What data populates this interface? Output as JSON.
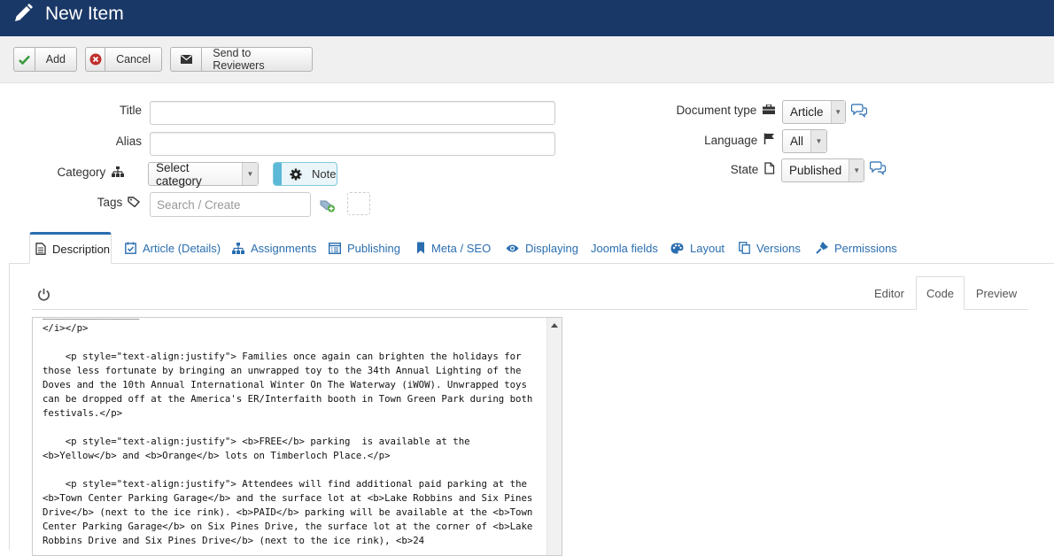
{
  "header": {
    "title": "New Item"
  },
  "toolbar": {
    "add_label": "Add",
    "cancel_label": "Cancel",
    "send_label": "Send to Reviewers"
  },
  "form": {
    "title_label": "Title",
    "title_value": "",
    "alias_label": "Alias",
    "alias_value": "",
    "category_label": "Category",
    "category_value": "Select category",
    "note_label": "Note",
    "tags_label": "Tags",
    "tags_placeholder": "Search / Create",
    "doctype_label": "Document type",
    "doctype_value": "Article",
    "language_label": "Language",
    "language_value": "All",
    "state_label": "State",
    "state_value": "Published"
  },
  "tabs": [
    {
      "label": "Description",
      "icon": "document-icon",
      "active": true
    },
    {
      "label": "Article (Details)",
      "icon": "calendar-check-icon"
    },
    {
      "label": "Assignments",
      "icon": "sitemap-icon"
    },
    {
      "label": "Publishing",
      "icon": "list-box-icon"
    },
    {
      "label": "Meta / SEO",
      "icon": "bookmark-icon"
    },
    {
      "label": "Displaying",
      "icon": "eye-icon"
    },
    {
      "label": "Joomla fields",
      "icon": ""
    },
    {
      "label": "Layout",
      "icon": "palette-icon"
    },
    {
      "label": "Versions",
      "icon": "copy-icon"
    },
    {
      "label": "Permissions",
      "icon": "plug-icon"
    }
  ],
  "editor": {
    "modes": [
      "Editor",
      "Code",
      "Preview"
    ],
    "active_mode": "Code",
    "code": "_________________\n</i></p>\n\n    <p style=\"text-align:justify\"> Families once again can brighten the holidays for those less fortunate by bringing an unwrapped toy to the 34th Annual Lighting of the Doves and the 10th Annual International Winter On The Waterway (iWOW). Unwrapped toys can be dropped off at the America's ER/Interfaith booth in Town Green Park during both festivals.</p>\n\n    <p style=\"text-align:justify\"> <b>FREE</b> parking  is available at the <b>Yellow</b> and <b>Orange</b> lots on Timberloch Place.</p>\n\n    <p style=\"text-align:justify\"> Attendees will find additional paid parking at the <b>Town Center Parking Garage</b> and the surface lot at <b>Lake Robbins and Six Pines Drive</b> (next to the ice rink). <b>PAID</b> parking will be available at the <b>Town Center Parking Garage</b> on Six Pines Drive, the surface lot at the corner of <b>Lake Robbins Drive and Six Pines Drive</b> (next to the ice rink), <b>24"
  },
  "colors": {
    "header_bg": "#1a3867",
    "link_blue": "#2a6eb0",
    "note_accent": "#5bb8d6",
    "add_check": "#3c9a3c",
    "cancel_red": "#c0302d"
  }
}
